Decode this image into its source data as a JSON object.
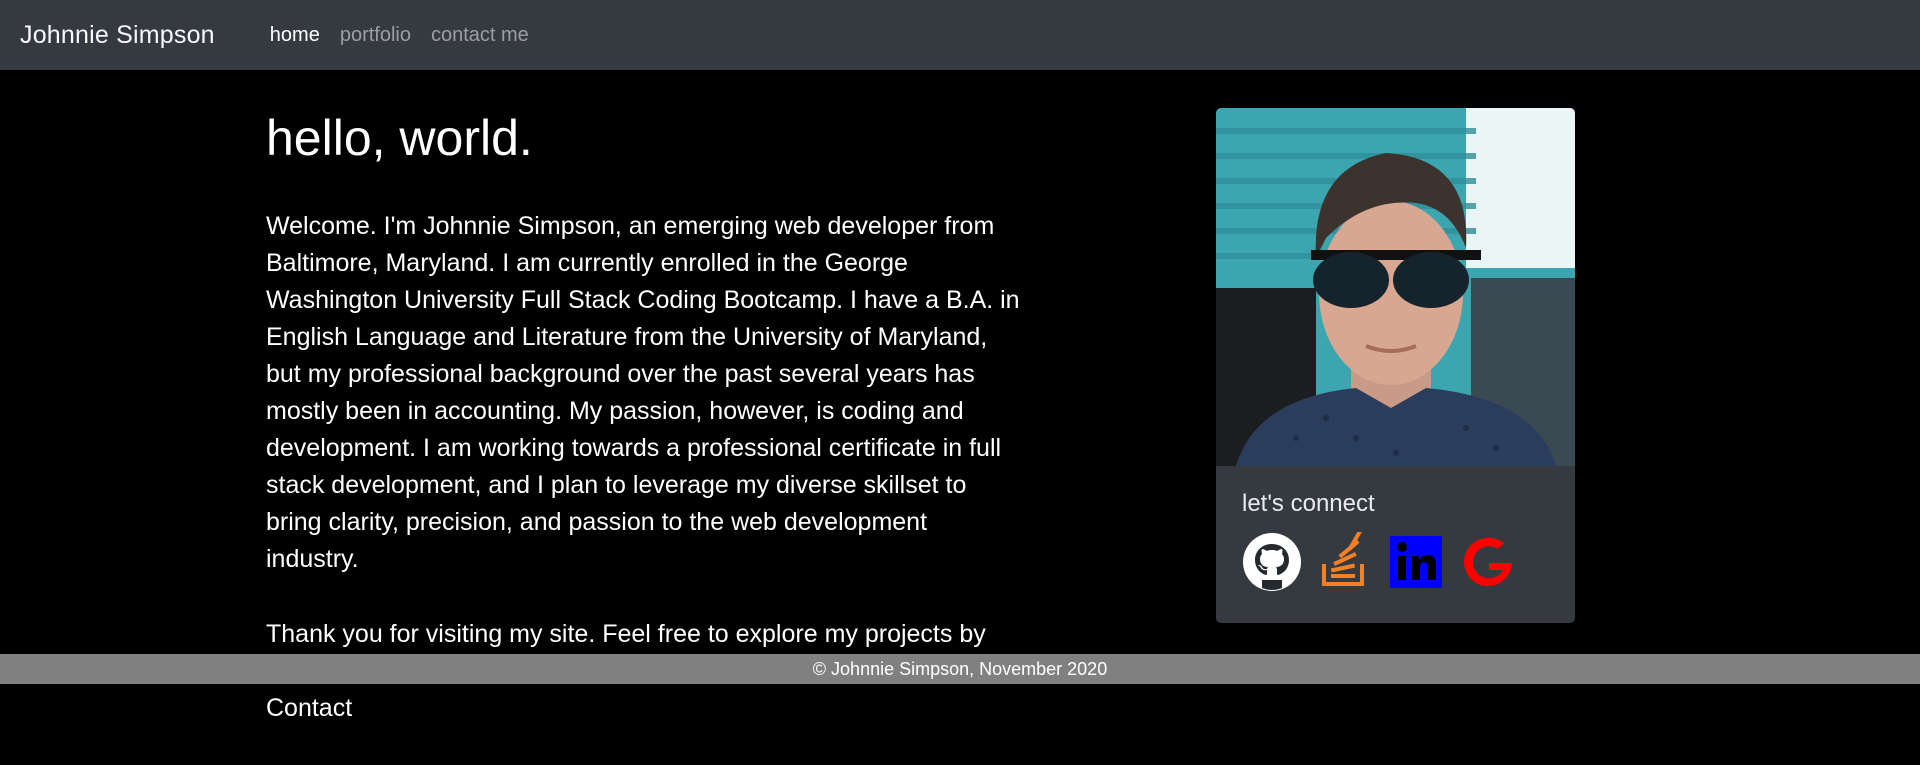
{
  "nav": {
    "brand": "Johnnie Simpson",
    "links": [
      {
        "label": "home"
      },
      {
        "label": "portfolio"
      },
      {
        "label": "contact me"
      }
    ]
  },
  "main": {
    "title": "hello, world.",
    "paragraph1": "Welcome. I'm Johnnie Simpson, an emerging web developer from Baltimore, Maryland. I am currently enrolled in the George Washington University Full Stack Coding Bootcamp. I have a B.A. in English Language and Literature from the University of Maryland, but my professional background over the past several years has mostly been in accounting. My passion, however, is coding and development. I am working towards a professional certificate in full stack development, and I plan to leverage my diverse skillset to bring clarity, precision, and passion to the web development industry.",
    "paragraph2": "Thank you for visiting my site. Feel free to explore my projects by clicking on the Portfolio tab. You can reach me directly at the Contact"
  },
  "card": {
    "connect_title": "let's connect",
    "icons": [
      "github-icon",
      "stackoverflow-icon",
      "linkedin-icon",
      "google-icon"
    ]
  },
  "footer": {
    "text": "© Johnnie Simpson, November 2020"
  },
  "colors": {
    "navbar": "#343a40",
    "background": "#000000",
    "footer": "#808080",
    "stackoverflow": "#f48024",
    "linkedin": "#0000ff",
    "google": "#ff0000"
  }
}
